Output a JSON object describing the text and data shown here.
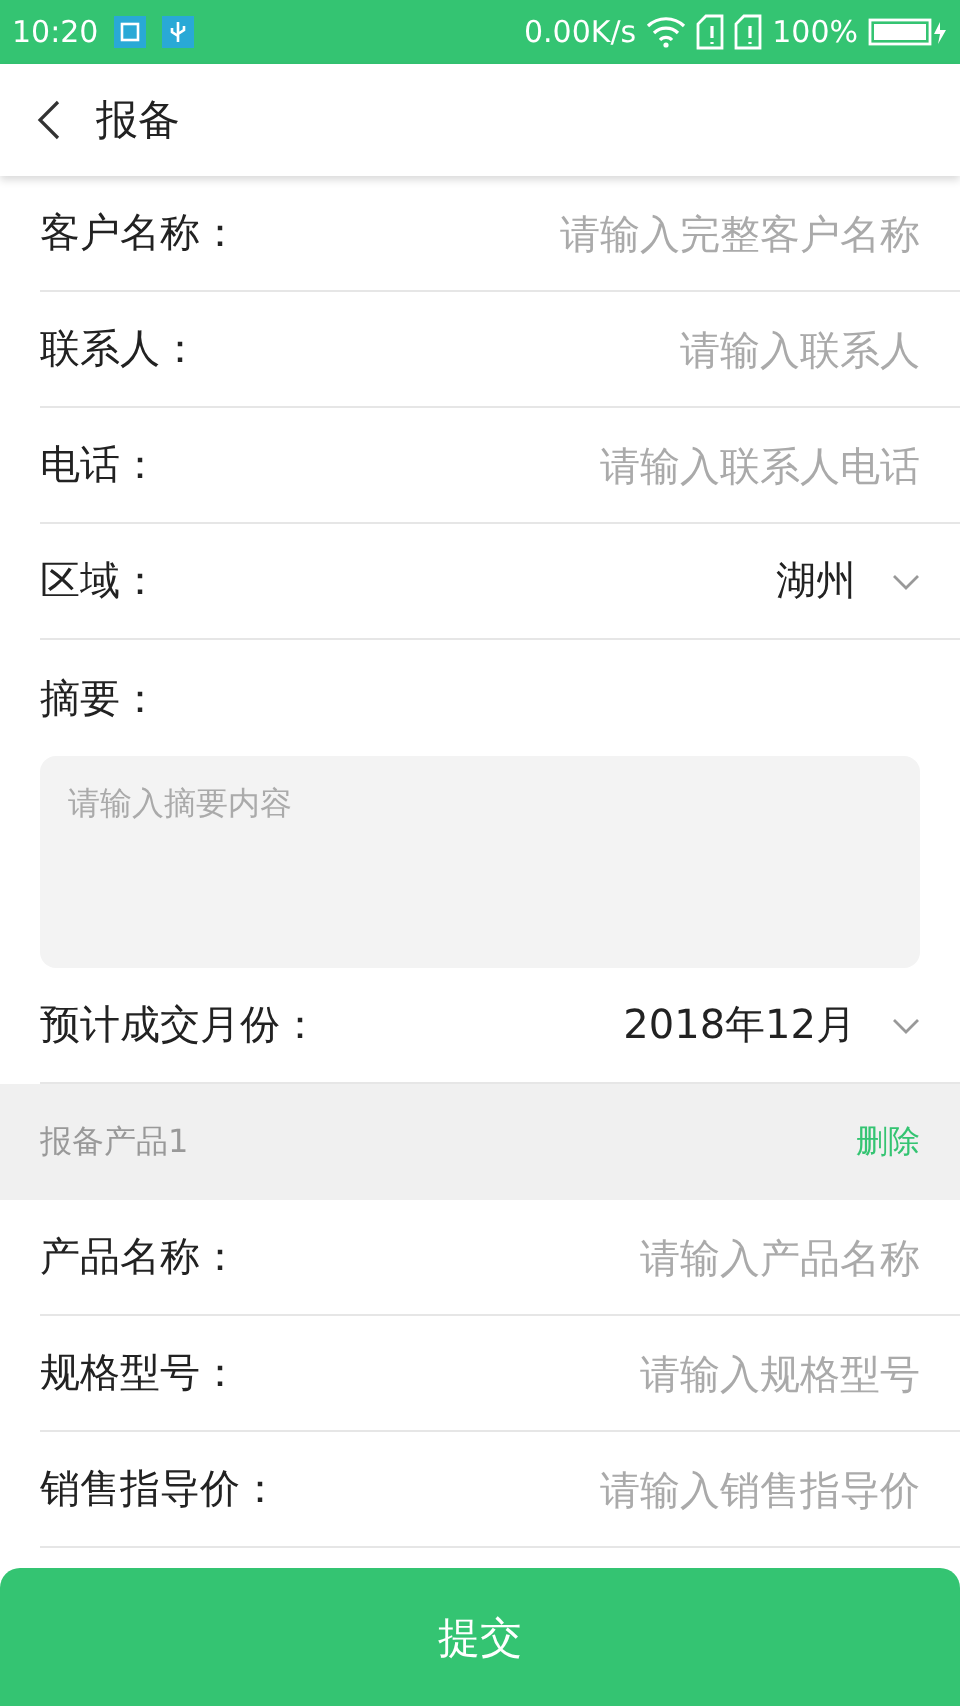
{
  "status_bar": {
    "time": "10:20",
    "net_speed": "0.00K/s",
    "battery": "100%"
  },
  "header": {
    "title": "报备"
  },
  "fields": [
    {
      "kind": "input",
      "label": "客户名称：",
      "placeholder": "请输入完整客户名称"
    },
    {
      "kind": "input",
      "label": "联系人：",
      "placeholder": "请输入联系人"
    },
    {
      "kind": "input",
      "label": "电话：",
      "placeholder": "请输入联系人电话"
    },
    {
      "kind": "select",
      "label": "区域：",
      "value": "湖州"
    },
    {
      "kind": "textarea",
      "label": "摘要：",
      "placeholder": "请输入摘要内容"
    },
    {
      "kind": "select",
      "label": "预计成交月份：",
      "value": "2018年12月"
    }
  ],
  "product_section": {
    "title": "报备产品1",
    "action": "删除"
  },
  "product_fields": [
    {
      "kind": "input",
      "label": "产品名称：",
      "placeholder": "请输入产品名称"
    },
    {
      "kind": "input",
      "label": "规格型号：",
      "placeholder": "请输入规格型号"
    },
    {
      "kind": "input",
      "label": "销售指导价：",
      "placeholder": "请输入销售指导价"
    }
  ],
  "submit_button": "提交"
}
